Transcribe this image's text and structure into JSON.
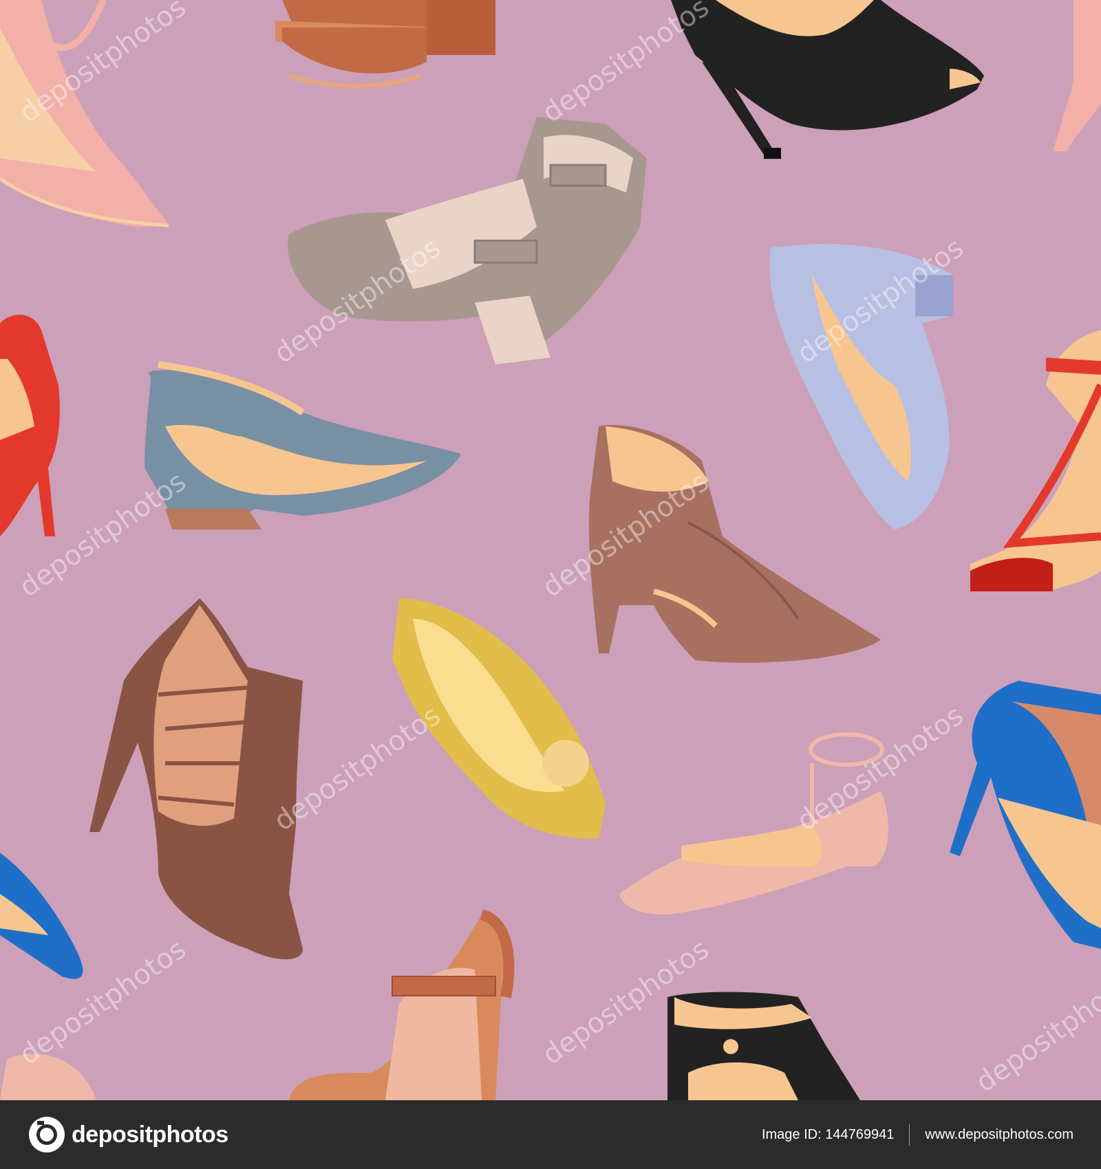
{
  "scene": {
    "background_color": "#cca0b8",
    "subject": "seamless pattern of women's high heel shoes, pumps, sandals and flats",
    "palette": [
      "#f3b0a8",
      "#c26a45",
      "#222222",
      "#a8978f",
      "#b7bfe2",
      "#e3392c",
      "#7890a3",
      "#a87060",
      "#8a5444",
      "#e2bd4a",
      "#f0b8a8",
      "#1f6fc8"
    ]
  },
  "watermark": {
    "text": "depositphotos"
  },
  "footer": {
    "brand": "depositphotos",
    "image_id": "Image ID: 144769941",
    "site": "www.depositphotos.com"
  }
}
